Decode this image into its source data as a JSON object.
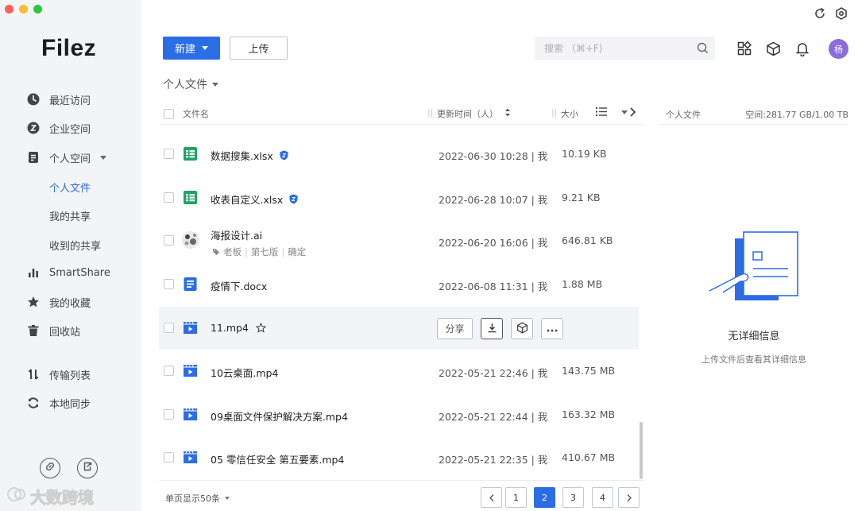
{
  "app": {
    "logo": "Filez"
  },
  "window": {
    "traffic_colors": [
      "#fe5f57",
      "#febc2e",
      "#28c840"
    ]
  },
  "sidebar": {
    "items": [
      {
        "label": "最近访问",
        "icon": "clock-icon"
      },
      {
        "label": "企业空间",
        "icon": "enterprise-icon"
      },
      {
        "label": "个人空间",
        "icon": "document-icon"
      },
      {
        "label": "SmartShare",
        "icon": "bar-chart-icon"
      },
      {
        "label": "我的收藏",
        "icon": "star-icon"
      },
      {
        "label": "回收站",
        "icon": "trash-icon"
      },
      {
        "label": "传输列表",
        "icon": "transfer-icon"
      },
      {
        "label": "本地同步",
        "icon": "sync-icon"
      }
    ],
    "sub_items": [
      {
        "label": "个人文件",
        "active": true
      },
      {
        "label": "我的共享",
        "active": false
      },
      {
        "label": "收到的共享",
        "active": false
      }
    ],
    "watermark": "大数跨境"
  },
  "toolbar": {
    "new_label": "新建",
    "upload_label": "上传",
    "search_placeholder": "搜索 （⌘+F)",
    "avatar_text": "杨",
    "accent": "#2b6de5"
  },
  "breadcrumb": {
    "label": "个人文件"
  },
  "table": {
    "headers": {
      "name": "文件名",
      "time": "更新时间（人）",
      "size": "大小"
    },
    "rows": [
      {
        "name": "数据搜集.xlsx",
        "type": "sheet",
        "time": "2022-06-30 10:28 | 我",
        "size": "10.19 KB",
        "badge": "shield"
      },
      {
        "name": "收表自定义.xlsx",
        "type": "sheet",
        "time": "2022-06-28 10:07 | 我",
        "size": "9.21 KB",
        "badge": "shield"
      },
      {
        "name": "海报设计.ai",
        "type": "image",
        "time": "2022-06-20 16:06 | 我",
        "size": "646.81 KB",
        "tags": [
          "老板",
          "第七版",
          "确定"
        ]
      },
      {
        "name": "疫情下.docx",
        "type": "doc",
        "time": "2022-06-08 11:31 | 我",
        "size": "1.88 MB"
      },
      {
        "name": "11.mp4",
        "type": "video",
        "hover": true,
        "share_label": "分享"
      },
      {
        "name": "10云桌面.mp4",
        "type": "video",
        "time": "2022-05-21 22:46 | 我",
        "size": "143.75 MB"
      },
      {
        "name": "09桌面文件保护解决方案.mp4",
        "type": "video",
        "time": "2022-05-21 22:44 | 我",
        "size": "163.32 MB"
      },
      {
        "name": "05 零信任安全 第五要素.mp4",
        "type": "video",
        "time": "2022-05-21 22:35 | 我",
        "size": "410.67 MB"
      }
    ]
  },
  "footer": {
    "per_page": "单页显示50条",
    "pages": [
      "1",
      "2",
      "3",
      "4"
    ],
    "current_page": "2"
  },
  "detail_panel": {
    "title": "个人文件",
    "space": "空间:281.77 GB/1.00 TB",
    "empty_title": "无详细信息",
    "empty_sub": "上传文件后查看其详细信息"
  }
}
